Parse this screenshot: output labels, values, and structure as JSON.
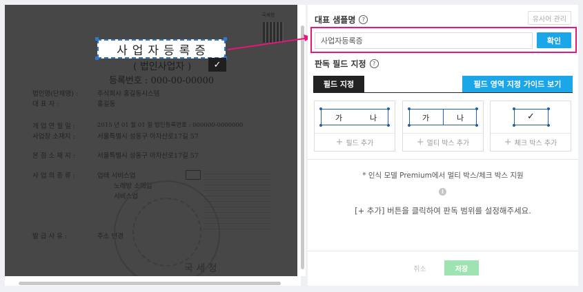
{
  "document": {
    "selected_text": "사업자등록증",
    "header_seal": "국세청",
    "subtitle": "( 법인사업자 )",
    "reg_number": "등록번호 : 000-00-00000",
    "rows": [
      {
        "label": "법인명(단체명) :",
        "value": "주식회사 홍길동시스템"
      },
      {
        "label": "대        표        자 :",
        "value": "홍길동"
      },
      {
        "label": "개 업 연 월 일 :",
        "value": "2015 년 01 월 01 일     법인등록번호 : 000000-0000000"
      },
      {
        "label": "사업장 소재지 :",
        "value": "서울특별시 성동구 아차산로17길 57"
      },
      {
        "label": "본 점 소 재 지 :",
        "value": "서울특별시 성동구 아차산로17길 57"
      },
      {
        "label": "사 업 의 종 류 :",
        "value": "업태  서비스업"
      },
      {
        "label": "",
        "value": "노래방 소매업"
      },
      {
        "label": "",
        "value": "서비스업"
      },
      {
        "label": "발 급 사 유 :",
        "value": "주소 변경"
      }
    ],
    "seal_text": "국 세 청",
    "check_mark": "✓"
  },
  "panel": {
    "sample_title": "대표 샘플명",
    "user_dict_button": "유사어 관리",
    "sample_input_value": "사업자등록증",
    "confirm_button": "확인",
    "field_title": "판독 필드 지정",
    "tab_label": "필드 지정",
    "guide_button": "필드 영역 지정 가이드 보기",
    "cards": [
      {
        "left": "가",
        "right": "나",
        "add_label": "필드 추가"
      },
      {
        "left": "가",
        "right": "나",
        "add_label": "멀티 박스 추가"
      },
      {
        "mark": "✓",
        "add_label": "체크 박스 추가"
      }
    ],
    "plus_sign": "+",
    "help_symbol": "?",
    "info_icon": "i",
    "premium_note": "* 인식 모델 Premium에서 멀티 박스/체크 박스 지원",
    "instruction": "[+ 추가] 버튼을 클릭하여 판독 범위를 설정해주세요.",
    "cancel_button": "취소",
    "save_button": "저장"
  },
  "colors": {
    "accent_blue": "#1aa6e8",
    "highlight_pink": "#e8167a",
    "save_green": "#9fe3b2",
    "doc_overlay": "#474747"
  }
}
